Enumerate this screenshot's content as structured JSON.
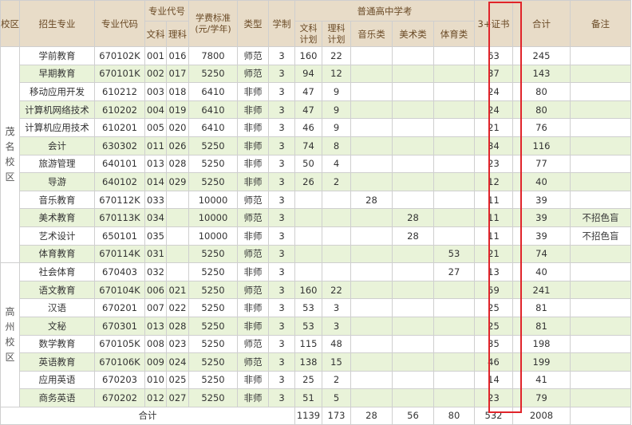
{
  "header": {
    "campus": "校区",
    "major": "招生专业",
    "code": "专业代码",
    "major_code": "专业代号",
    "wenke": "文科",
    "like": "理科",
    "fee": "学费标准",
    "fee_unit": "(元/学年)",
    "type": "类型",
    "years": "学制",
    "gaokao": "普通高中学考",
    "wenke_plan_1": "文科",
    "wenke_plan_2": "计划",
    "like_plan_1": "理科",
    "like_plan_2": "计划",
    "music": "音乐类",
    "art": "美术类",
    "sports": "体育类",
    "cert": "3+证书",
    "total": "合计",
    "remark": "备注"
  },
  "campuses": [
    {
      "name": "茂名校区",
      "rowspan": 12
    },
    {
      "name": "高州校区",
      "rowspan": 8
    }
  ],
  "rows": [
    {
      "major": "学前教育",
      "code": "670102K",
      "wen": "001",
      "li": "016",
      "fee": "7800",
      "type": "师范",
      "years": "3",
      "wenplan": "160",
      "liplan": "22",
      "music": "",
      "art": "",
      "sports": "",
      "cert": "63",
      "total": "245",
      "remark": ""
    },
    {
      "major": "早期教育",
      "code": "670101K",
      "wen": "002",
      "li": "017",
      "fee": "5250",
      "type": "师范",
      "years": "3",
      "wenplan": "94",
      "liplan": "12",
      "music": "",
      "art": "",
      "sports": "",
      "cert": "37",
      "total": "143",
      "remark": ""
    },
    {
      "major": "移动应用开发",
      "code": "610212",
      "wen": "003",
      "li": "018",
      "fee": "6410",
      "type": "非师",
      "years": "3",
      "wenplan": "47",
      "liplan": "9",
      "music": "",
      "art": "",
      "sports": "",
      "cert": "24",
      "total": "80",
      "remark": ""
    },
    {
      "major": "计算机网络技术",
      "code": "610202",
      "wen": "004",
      "li": "019",
      "fee": "6410",
      "type": "非师",
      "years": "3",
      "wenplan": "47",
      "liplan": "9",
      "music": "",
      "art": "",
      "sports": "",
      "cert": "24",
      "total": "80",
      "remark": ""
    },
    {
      "major": "计算机应用技术",
      "code": "610201",
      "wen": "005",
      "li": "020",
      "fee": "6410",
      "type": "非师",
      "years": "3",
      "wenplan": "46",
      "liplan": "9",
      "music": "",
      "art": "",
      "sports": "",
      "cert": "21",
      "total": "76",
      "remark": ""
    },
    {
      "major": "会计",
      "code": "630302",
      "wen": "011",
      "li": "026",
      "fee": "5250",
      "type": "非师",
      "years": "3",
      "wenplan": "74",
      "liplan": "8",
      "music": "",
      "art": "",
      "sports": "",
      "cert": "34",
      "total": "116",
      "remark": ""
    },
    {
      "major": "旅游管理",
      "code": "640101",
      "wen": "013",
      "li": "028",
      "fee": "5250",
      "type": "非师",
      "years": "3",
      "wenplan": "50",
      "liplan": "4",
      "music": "",
      "art": "",
      "sports": "",
      "cert": "23",
      "total": "77",
      "remark": ""
    },
    {
      "major": "导游",
      "code": "640102",
      "wen": "014",
      "li": "029",
      "fee": "5250",
      "type": "非师",
      "years": "3",
      "wenplan": "26",
      "liplan": "2",
      "music": "",
      "art": "",
      "sports": "",
      "cert": "12",
      "total": "40",
      "remark": ""
    },
    {
      "major": "音乐教育",
      "code": "670112K",
      "wen": "033",
      "li": "",
      "fee": "10000",
      "type": "师范",
      "years": "3",
      "wenplan": "",
      "liplan": "",
      "music": "28",
      "art": "",
      "sports": "",
      "cert": "11",
      "total": "39",
      "remark": ""
    },
    {
      "major": "美术教育",
      "code": "670113K",
      "wen": "034",
      "li": "",
      "fee": "10000",
      "type": "师范",
      "years": "3",
      "wenplan": "",
      "liplan": "",
      "music": "",
      "art": "28",
      "sports": "",
      "cert": "11",
      "total": "39",
      "remark": "不招色盲"
    },
    {
      "major": "艺术设计",
      "code": "650101",
      "wen": "035",
      "li": "",
      "fee": "10000",
      "type": "非师",
      "years": "3",
      "wenplan": "",
      "liplan": "",
      "music": "",
      "art": "28",
      "sports": "",
      "cert": "11",
      "total": "39",
      "remark": "不招色盲"
    },
    {
      "major": "体育教育",
      "code": "670114K",
      "wen": "031",
      "li": "",
      "fee": "5250",
      "type": "师范",
      "years": "3",
      "wenplan": "",
      "liplan": "",
      "music": "",
      "art": "",
      "sports": "53",
      "cert": "21",
      "total": "74",
      "remark": ""
    },
    {
      "major": "社会体育",
      "code": "670403",
      "wen": "032",
      "li": "",
      "fee": "5250",
      "type": "非师",
      "years": "3",
      "wenplan": "",
      "liplan": "",
      "music": "",
      "art": "",
      "sports": "27",
      "cert": "13",
      "total": "40",
      "remark": ""
    },
    {
      "major": "语文教育",
      "code": "670104K",
      "wen": "006",
      "li": "021",
      "fee": "5250",
      "type": "师范",
      "years": "3",
      "wenplan": "160",
      "liplan": "22",
      "music": "",
      "art": "",
      "sports": "",
      "cert": "59",
      "total": "241",
      "remark": ""
    },
    {
      "major": "汉语",
      "code": "670201",
      "wen": "007",
      "li": "022",
      "fee": "5250",
      "type": "非师",
      "years": "3",
      "wenplan": "53",
      "liplan": "3",
      "music": "",
      "art": "",
      "sports": "",
      "cert": "25",
      "total": "81",
      "remark": ""
    },
    {
      "major": "文秘",
      "code": "670301",
      "wen": "013",
      "li": "028",
      "fee": "5250",
      "type": "非师",
      "years": "3",
      "wenplan": "53",
      "liplan": "3",
      "music": "",
      "art": "",
      "sports": "",
      "cert": "25",
      "total": "81",
      "remark": ""
    },
    {
      "major": "数学教育",
      "code": "670105K",
      "wen": "008",
      "li": "023",
      "fee": "5250",
      "type": "师范",
      "years": "3",
      "wenplan": "115",
      "liplan": "48",
      "music": "",
      "art": "",
      "sports": "",
      "cert": "35",
      "total": "198",
      "remark": ""
    },
    {
      "major": "英语教育",
      "code": "670106K",
      "wen": "009",
      "li": "024",
      "fee": "5250",
      "type": "师范",
      "years": "3",
      "wenplan": "138",
      "liplan": "15",
      "music": "",
      "art": "",
      "sports": "",
      "cert": "46",
      "total": "199",
      "remark": ""
    },
    {
      "major": "应用英语",
      "code": "670203",
      "wen": "010",
      "li": "025",
      "fee": "5250",
      "type": "非师",
      "years": "3",
      "wenplan": "25",
      "liplan": "2",
      "music": "",
      "art": "",
      "sports": "",
      "cert": "14",
      "total": "41",
      "remark": ""
    },
    {
      "major": "商务英语",
      "code": "670202",
      "wen": "012",
      "li": "027",
      "fee": "5250",
      "type": "非师",
      "years": "3",
      "wenplan": "51",
      "liplan": "5",
      "music": "",
      "art": "",
      "sports": "",
      "cert": "23",
      "total": "79",
      "remark": ""
    }
  ],
  "totals": {
    "label": "合计",
    "wenplan": "1139",
    "liplan": "173",
    "music": "28",
    "art": "56",
    "sports": "80",
    "cert": "532",
    "total": "2008"
  },
  "colors": {
    "highlight": "#e0242a",
    "row_green": "#e9f3d9",
    "header_bg": "#e8dcc8"
  }
}
